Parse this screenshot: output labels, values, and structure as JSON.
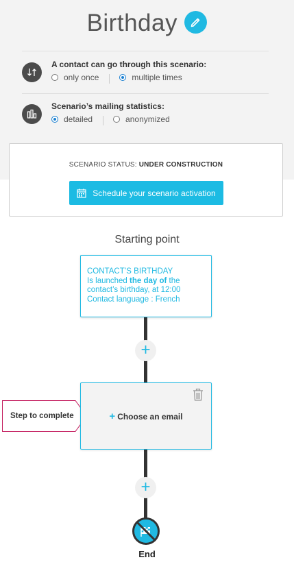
{
  "header": {
    "title": "Birthday",
    "edit_icon": "pencil-icon"
  },
  "options": {
    "passage": {
      "label": "A contact can go through this scenario:",
      "icon": "arrows-updown-icon",
      "choices": [
        "only once",
        "multiple times"
      ],
      "selected": "multiple times"
    },
    "statistics": {
      "label": "Scenario’s mailing statistics:",
      "icon": "bar-chart-icon",
      "choices": [
        "detailed",
        "anonymized"
      ],
      "selected": "detailed"
    }
  },
  "status": {
    "prefix": "SCENARIO STATUS:",
    "value": "UNDER CONSTRUCTION",
    "schedule_button": "Schedule your scenario activation"
  },
  "flow": {
    "starting_point_title": "Starting point",
    "trigger": {
      "title": "CONTACT’S BIRTHDAY",
      "line1_pre": "Is launched ",
      "line1_bold": "the day of",
      "line1_post": " the",
      "line2": "contact’s birthday, at 12:00",
      "line3": "Contact language : French"
    },
    "add_symbol": "+",
    "step": {
      "choose_label": "Choose an email",
      "callout": "Step to complete"
    },
    "end_label": "End"
  },
  "colors": {
    "accent": "#20b9e2",
    "callout_border": "#c2185b",
    "line": "#333333"
  }
}
